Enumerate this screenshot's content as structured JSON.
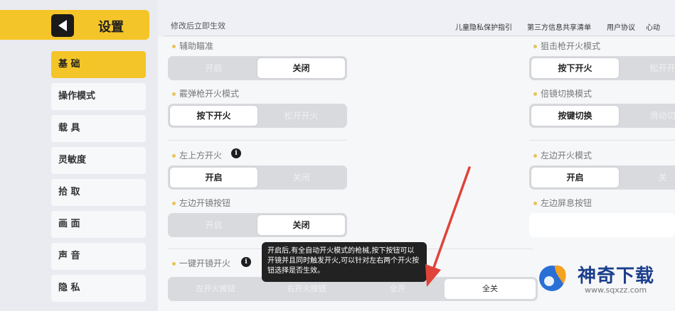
{
  "sidebar": {
    "title": "设置",
    "items": [
      {
        "label": "基 础",
        "active": true
      },
      {
        "label": "操作模式",
        "active": false
      },
      {
        "label": "载 具",
        "active": false
      },
      {
        "label": "灵敏度",
        "active": false
      },
      {
        "label": "拾 取",
        "active": false
      },
      {
        "label": "画 面",
        "active": false
      },
      {
        "label": "声 音",
        "active": false
      },
      {
        "label": "隐 私",
        "active": false
      }
    ]
  },
  "header": {
    "notice": "修改后立即生效",
    "links": [
      "儿童隐私保护指引",
      "第三方信息共享清单",
      "用户协议",
      "心动"
    ]
  },
  "left_sections": [
    {
      "label": "辅助瞄准",
      "options": [
        "开启",
        "关闭"
      ],
      "selected": 1
    },
    {
      "label": "霰弹枪开火模式",
      "options": [
        "按下开火",
        "松开开火"
      ],
      "selected": 0
    },
    {
      "label": "左上方开火",
      "options": [
        "开启",
        "关闭"
      ],
      "selected": 0
    },
    {
      "label": "左边开镜按钮",
      "options": [
        "开启",
        "关闭"
      ],
      "selected": 1
    }
  ],
  "right_sections": [
    {
      "label": "狙击枪开火模式",
      "options": [
        "按下开火",
        "松开开"
      ],
      "selected": 0
    },
    {
      "label": "倍镜切换模式",
      "options": [
        "按键切换",
        "滑动切"
      ],
      "selected": 0
    },
    {
      "label": "左边开火模式",
      "options": [
        "开启",
        "关"
      ],
      "selected": 0
    },
    {
      "label": "左边屏息按钮",
      "options": [],
      "selected": null
    }
  ],
  "one_key": {
    "label": "一键开镜开火",
    "options": [
      "左开火按钮",
      "右开火按钮",
      "全开",
      "全关"
    ],
    "selected": 3
  },
  "tooltip": {
    "text": "开启后,有全自动开火模式的枪械,按下按钮可以开镜并且同时触发开火,可以针对左右两个开火按钮选择是否生效。"
  },
  "watermark": {
    "title": "神奇下载",
    "url": "www.sqxzz.com"
  },
  "colors": {
    "accent": "#f4c528",
    "toggle_bg": "#d8dade",
    "arrow": "#e0433a"
  },
  "icons": {
    "back": "back-arrow-icon",
    "info": "info-icon"
  }
}
